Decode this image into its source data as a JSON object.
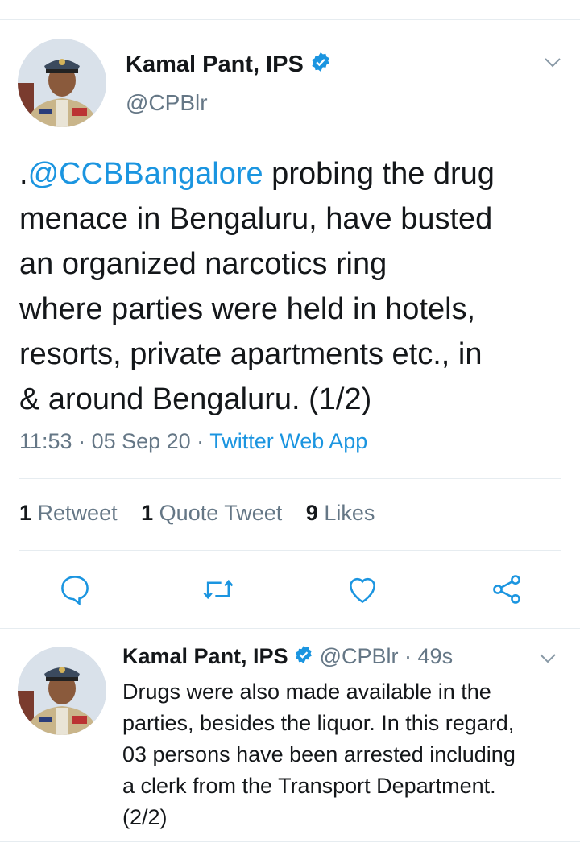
{
  "main_tweet": {
    "author_name": "Kamal Pant, IPS",
    "author_handle": "@CPBlr",
    "text_prefix": ".",
    "mention": "@CCBBangalore",
    "text_lines": [
      " probing the drug",
      "menace in Bengaluru, have busted",
      "an organized narcotics ring",
      "where parties were held in hotels,",
      "resorts, private apartments etc., in",
      "& around Bengaluru. (1/2)"
    ],
    "time": "11:53",
    "date": "05 Sep 20",
    "dot": " · ",
    "source": "Twitter Web App",
    "retweets_count": "1",
    "retweets_label": "Retweet",
    "quotes_count": "1",
    "quotes_label": "Quote Tweet",
    "likes_count": "9",
    "likes_label": "Likes"
  },
  "reply_tweet": {
    "author_name": "Kamal Pant, IPS",
    "author_handle": "@CPBlr",
    "age": "49s",
    "dot": " · ",
    "text_lines": [
      "Drugs were also made available in the",
      "parties, besides the liquor. In this regard,",
      "03 persons have been arrested including",
      "a clerk from the Transport Department.",
      "(2/2)"
    ]
  },
  "colors": {
    "accent": "#1b95e0",
    "secondary_text": "#657786",
    "divider": "#e6ecf0"
  },
  "icons": {
    "reply": "reply-icon",
    "retweet": "retweet-icon",
    "like": "heart-icon",
    "share": "share-icon",
    "verified": "verified-badge-icon",
    "more": "chevron-down-icon"
  }
}
